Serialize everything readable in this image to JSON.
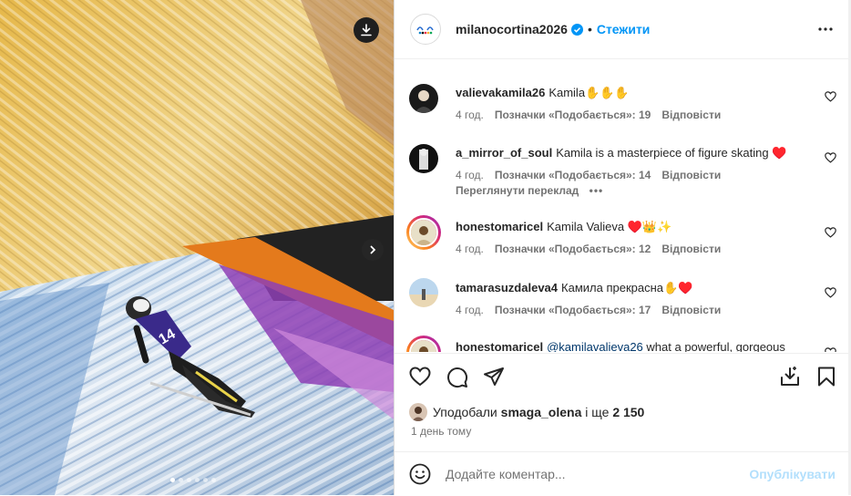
{
  "post": {
    "username": "milanocortina2026",
    "separator": "•",
    "follow_label": "Стежити",
    "carousel": {
      "total_slides": 6,
      "active_slide": 1
    }
  },
  "comments": [
    {
      "user": "valievakamila26",
      "text": "Kamila✋✋✋",
      "time": "4 год.",
      "likes": "Позначки «Подобається»: 19",
      "reply": "Відповісти"
    },
    {
      "user": "a_mirror_of_soul",
      "text": "Kamila is a masterpiece of figure skating ♥️",
      "time": "4 год.",
      "likes": "Позначки «Подобається»: 14",
      "reply": "Відповісти",
      "translate": "Переглянути переклад"
    },
    {
      "user": "honestomaricel",
      "text": "Kamila Valieva ♥️👑✨",
      "time": "4 год.",
      "likes": "Позначки «Подобається»: 12",
      "reply": "Відповісти"
    },
    {
      "user": "tamarasuzdaleva4",
      "text": "Камила прекрасна✋♥️",
      "time": "4 год.",
      "likes": "Позначки «Подобається»: 17",
      "reply": "Відповісти"
    },
    {
      "user": "honestomaricel",
      "mention": "@kamilavalieva26",
      "text": " what a powerful, gorgeous"
    }
  ],
  "likes_summary": {
    "prefix": "Уподобали ",
    "user": "smaga_olena",
    "middle": " і ще ",
    "count": "2 150"
  },
  "posted_time": "1 день тому",
  "composer": {
    "placeholder": "Додайте коментар...",
    "post_label": "Опублікувати"
  },
  "colors": {
    "accent": "#0095f6",
    "heart_red": "#b3121d",
    "text": "#262626",
    "muted": "#737373"
  }
}
